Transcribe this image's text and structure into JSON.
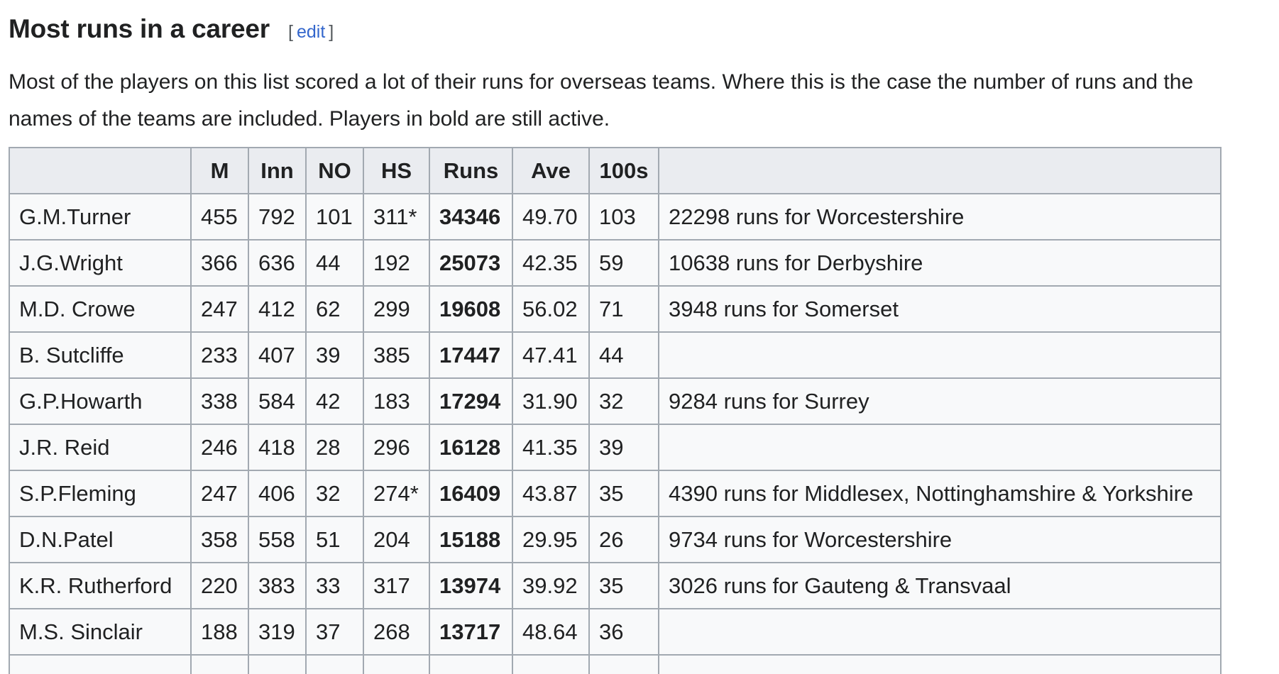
{
  "section": {
    "title": "Most runs in a career",
    "edit_open": "[",
    "edit_label": "edit",
    "edit_close": "]",
    "intro_line1": "Most of the players on this list scored a lot of their runs for overseas teams. Where this is the case the number of runs and the",
    "intro_line2": "names of the teams are included. Players in bold are still active."
  },
  "table": {
    "headers": [
      "",
      "M",
      "Inn",
      "NO",
      "HS",
      "Runs",
      "Ave",
      "100s",
      ""
    ],
    "rows": [
      {
        "name": "G.M.Turner",
        "m": "455",
        "inn": "792",
        "no": "101",
        "hs": "311*",
        "runs": "34346",
        "ave": "49.70",
        "hundreds": "103",
        "note": "22298 runs for Worcestershire"
      },
      {
        "name": "J.G.Wright",
        "m": "366",
        "inn": "636",
        "no": "44",
        "hs": "192",
        "runs": "25073",
        "ave": "42.35",
        "hundreds": "59",
        "note": "10638 runs for Derbyshire"
      },
      {
        "name": "M.D. Crowe",
        "m": "247",
        "inn": "412",
        "no": "62",
        "hs": "299",
        "runs": "19608",
        "ave": "56.02",
        "hundreds": "71",
        "note": "3948 runs for Somerset"
      },
      {
        "name": "B. Sutcliffe",
        "m": "233",
        "inn": "407",
        "no": "39",
        "hs": "385",
        "runs": "17447",
        "ave": "47.41",
        "hundreds": "44",
        "note": ""
      },
      {
        "name": "G.P.Howarth",
        "m": "338",
        "inn": "584",
        "no": "42",
        "hs": "183",
        "runs": "17294",
        "ave": "31.90",
        "hundreds": "32",
        "note": "9284 runs for Surrey"
      },
      {
        "name": "J.R. Reid",
        "m": "246",
        "inn": "418",
        "no": "28",
        "hs": "296",
        "runs": "16128",
        "ave": "41.35",
        "hundreds": "39",
        "note": ""
      },
      {
        "name": "S.P.Fleming",
        "m": "247",
        "inn": "406",
        "no": "32",
        "hs": "274*",
        "runs": "16409",
        "ave": "43.87",
        "hundreds": "35",
        "note": "4390 runs for Middlesex, Nottinghamshire & Yorkshire"
      },
      {
        "name": "D.N.Patel",
        "m": "358",
        "inn": "558",
        "no": "51",
        "hs": "204",
        "runs": "15188",
        "ave": "29.95",
        "hundreds": "26",
        "note": "9734 runs for Worcestershire"
      },
      {
        "name": "K.R. Rutherford",
        "m": "220",
        "inn": "383",
        "no": "33",
        "hs": "317",
        "runs": "13974",
        "ave": "39.92",
        "hundreds": "35",
        "note": "3026 runs for Gauteng & Transvaal"
      },
      {
        "name": "M.S. Sinclair",
        "m": "188",
        "inn": "319",
        "no": "37",
        "hs": "268",
        "runs": "13717",
        "ave": "48.64",
        "hundreds": "36",
        "note": ""
      }
    ]
  }
}
